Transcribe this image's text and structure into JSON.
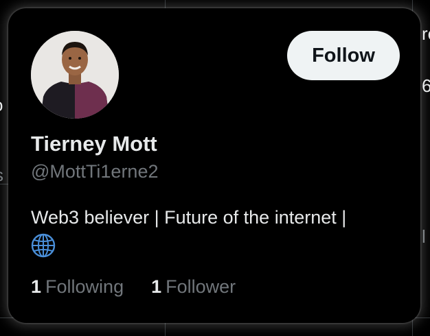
{
  "background": {
    "fragments": [
      "o",
      "s",
      "re",
      "6",
      "l"
    ]
  },
  "profile_card": {
    "display_name": "Tierney Mott",
    "handle": "@MottTi1erne2",
    "follow_label": "Follow",
    "bio_text": "Web3 believer | Future of the internet |",
    "bio_emoji_icon": "globe-icon",
    "following": {
      "count": "1",
      "label": "Following"
    },
    "followers": {
      "count": "1",
      "label": "Follower"
    },
    "avatar_icon": "profile-photo"
  },
  "colors": {
    "background": "#000000",
    "primary_text": "#e7e9ea",
    "secondary_text": "#71767b",
    "button_bg": "#eff3f4",
    "button_text": "#0f1419",
    "globe": "#4a8fd9"
  }
}
